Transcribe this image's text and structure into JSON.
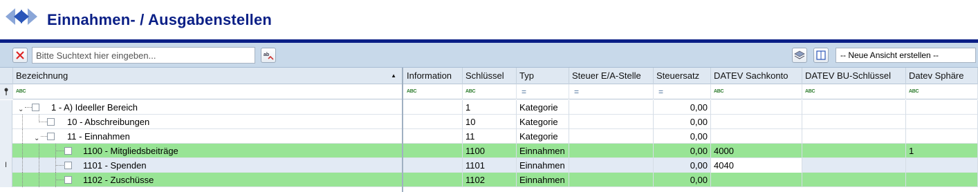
{
  "header": {
    "title": "Einnahmen- / Ausgabenstellen",
    "nav_icon": "back-forward-arrows-icon",
    "accent_color": "#0a1f86"
  },
  "toolbar": {
    "clear_icon": "close-icon",
    "search_placeholder": "Bitte Suchtext hier eingeben...",
    "spellcheck_icon": "abc-spellcheck-icon",
    "layers_icon": "layers-icon",
    "book_icon": "book-icon",
    "view_select_value": "-- Neue Ansicht erstellen --"
  },
  "columns": [
    {
      "key": "bezeichnung",
      "label": "Bezeichnung",
      "filter": "abc"
    },
    {
      "key": "information",
      "label": "Information",
      "filter": "abc"
    },
    {
      "key": "schluessel",
      "label": "Schlüssel",
      "filter": "abc"
    },
    {
      "key": "typ",
      "label": "Typ",
      "filter": "eq"
    },
    {
      "key": "steuer_ea",
      "label": "Steuer E/A-Stelle",
      "filter": "eq"
    },
    {
      "key": "steuersatz",
      "label": "Steuersatz",
      "filter": "eq"
    },
    {
      "key": "datev_sachkonto",
      "label": "DATEV Sachkonto",
      "filter": "abc"
    },
    {
      "key": "datev_bu",
      "label": "DATEV BU-Schlüssel",
      "filter": "abc"
    },
    {
      "key": "datev_sphaere",
      "label": "Datev Sphäre",
      "filter": "abc"
    }
  ],
  "filter_labels": {
    "abc": "ABC",
    "eq": "="
  },
  "sort_indicator": "▲",
  "rows": [
    {
      "level": 0,
      "expanded": true,
      "bezeichnung": "1 - A) Ideeller Bereich",
      "information": "",
      "schluessel": "1",
      "typ": "Kategorie",
      "steuer_ea": "",
      "steuersatz": "0,00",
      "datev_sachkonto": "",
      "datev_bu": "",
      "datev_sphaere": "",
      "style": "cat"
    },
    {
      "level": 1,
      "expanded": false,
      "bezeichnung": "10 - Abschreibungen",
      "information": "",
      "schluessel": "10",
      "typ": "Kategorie",
      "steuer_ea": "",
      "steuersatz": "0,00",
      "datev_sachkonto": "",
      "datev_bu": "",
      "datev_sphaere": "",
      "style": "cat"
    },
    {
      "level": 1,
      "expanded": true,
      "bezeichnung": "11 - Einnahmen",
      "information": "",
      "schluessel": "11",
      "typ": "Kategorie",
      "steuer_ea": "",
      "steuersatz": "0,00",
      "datev_sachkonto": "",
      "datev_bu": "",
      "datev_sphaere": "",
      "style": "cat"
    },
    {
      "level": 2,
      "expanded": false,
      "bezeichnung": "1100 - Mitgliedsbeiträge",
      "information": "",
      "schluessel": "1100",
      "typ": "Einnahmen",
      "steuer_ea": "",
      "steuersatz": "0,00",
      "datev_sachkonto": "4000",
      "datev_bu": "",
      "datev_sphaere": "1",
      "style": "green"
    },
    {
      "level": 2,
      "expanded": false,
      "bezeichnung": "1101 - Spenden",
      "information": "",
      "schluessel": "1101",
      "typ": "Einnahmen",
      "steuer_ea": "",
      "steuersatz": "0,00",
      "datev_sachkonto": "4040",
      "datev_bu": "",
      "datev_sphaere": "",
      "style": "sel",
      "indicator": "I"
    },
    {
      "level": 2,
      "expanded": false,
      "bezeichnung": "1102 - Zuschüsse",
      "information": "",
      "schluessel": "1102",
      "typ": "Einnahmen",
      "steuer_ea": "",
      "steuersatz": "0,00",
      "datev_sachkonto": "",
      "datev_bu": "",
      "datev_sphaere": "",
      "style": "green"
    }
  ],
  "row_colors": {
    "green": "#98e495",
    "selected": "#e2eaf4"
  }
}
